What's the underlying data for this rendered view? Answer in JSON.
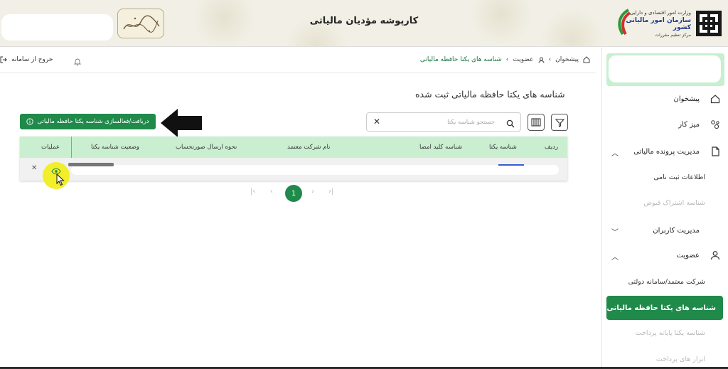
{
  "header": {
    "title": "کارپوشه مؤدیان مالیاتی",
    "logo_line1": "وزارت امور اقتصادی و دارایی",
    "logo_line2": "سازمان امور مالیاتی کشور",
    "logo_line3": "مرکز تنظیم مقررات"
  },
  "topbar": {
    "logout_label": "خروج از سامانه",
    "breadcrumb": [
      "پیشخوان",
      "عضویت",
      "شناسه های یکتا حافظه مالیاتی"
    ]
  },
  "sidebar": {
    "items": [
      {
        "label": "پیشخوان",
        "icon": "home-icon"
      },
      {
        "label": "میز کار",
        "icon": "workspace-icon"
      },
      {
        "label": "مدیریت پرونده مالیاتی",
        "icon": "file-icon",
        "expanded": true
      },
      {
        "label": "مدیریت کاربران",
        "expanded": false
      },
      {
        "label": "عضویت",
        "icon": "user-icon",
        "expanded": true
      }
    ],
    "sub_file": [
      {
        "label": "اطلاعات ثبت نامی",
        "disabled": false
      },
      {
        "label": "شناسه اشتراک قبوض",
        "disabled": true
      }
    ],
    "sub_membership": [
      {
        "label": "شرکت معتمد/سامانه دولتی",
        "disabled": false
      },
      {
        "label": "شناسه های یکتا حافظه مالیاتی",
        "active": true
      },
      {
        "label": "شناسه یکتا پایانه پرداخت",
        "disabled": true
      },
      {
        "label": "ابزار های پرداخت",
        "disabled": true
      }
    ]
  },
  "main": {
    "page_title": "شناسه های یکتا حافظه مالیاتی ثبت شده",
    "search_placeholder": "جستجو شناسه یکتا",
    "action_button": "دریافت/فعالسازی شناسه یکتا حافظه مالیاتی",
    "table_headers": [
      "ردیف",
      "شناسه یکتا",
      "شناسه کلید امضا",
      "نام شرکت معتمد",
      "نحوه ارسال صورتحساب",
      "وضعیت شناسه یکتا",
      "عملیات"
    ],
    "pagination": {
      "current": "1"
    }
  },
  "colors": {
    "accent": "#1f8a4a",
    "table_header": "#c9efd0",
    "highlight": "#f2ee2a"
  }
}
